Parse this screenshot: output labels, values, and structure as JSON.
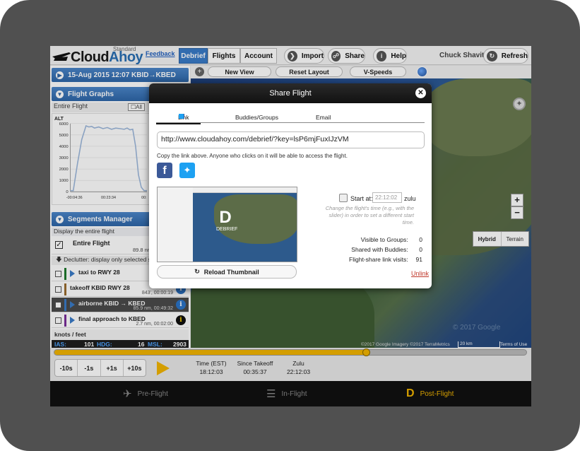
{
  "app": {
    "logo_text_a": "Cloud",
    "logo_text_b": "Ahoy",
    "edition": "Standard",
    "feedback_link": "Feedback"
  },
  "nav": {
    "tabs": [
      {
        "label": "Debrief",
        "active": true
      },
      {
        "label": "Flights",
        "active": false
      },
      {
        "label": "Account",
        "active": false
      }
    ],
    "import_label": "Import",
    "share_label": "Share",
    "help_label": "Help",
    "user_name": "Chuck Shavit",
    "refresh_label": "Refresh"
  },
  "toolbar": {
    "new_view": "New View",
    "reset_layout": "Reset Layout",
    "vspeeds": "V-Speeds"
  },
  "left": {
    "flight_header": "15-Aug 2015 12:07   KBID→KBED",
    "graphs_header": "Flight Graphs",
    "graphs_sub": "Entire Flight",
    "all_button": "All",
    "segments_header": "Segments Manager",
    "segments_sub": "Display the entire flight",
    "entire_flight": {
      "title": "Entire Flight",
      "detail": "89.8 nm"
    },
    "declutter": "Declutter: display only selected s",
    "segments": [
      {
        "title": "taxi to RWY 28",
        "detail": "1605",
        "color": "#1f7a2e",
        "checked": false
      },
      {
        "title": "takeoff KBID RWY 28",
        "detail": "843', 00:00:19",
        "color": "#9a6b2e",
        "checked": false
      },
      {
        "title": "airborne KBID → KBED",
        "detail": "85.9 nm, 00:49:32",
        "color": "#3a7bc8",
        "checked": false
      },
      {
        "title": "final approach to KBED",
        "detail": "2.7 nm, 00:02:00",
        "color": "#7a2e9a",
        "checked": false
      }
    ],
    "units": "knots / feet",
    "readout": {
      "ias_label": "IAS:",
      "ias_value": "101",
      "hdg_label": "HDG:",
      "hdg_value": "16",
      "msl_label": "MSL:",
      "msl_value": "2903"
    }
  },
  "chart_data": {
    "type": "line",
    "ylabel": "ALT",
    "y_ticks": [
      0,
      1000,
      2000,
      3000,
      4000,
      5000,
      6000
    ],
    "ylim": [
      0,
      6000
    ],
    "x_ticks": [
      "-00:04:36",
      "00:23:34",
      "00:"
    ],
    "x": [
      0,
      2,
      5,
      8,
      11,
      13,
      15,
      17,
      20,
      23,
      26,
      29,
      32,
      35,
      38,
      40,
      42,
      44,
      46,
      48,
      50,
      52,
      54
    ],
    "values": [
      100,
      100,
      2500,
      4600,
      5800,
      5700,
      5750,
      5600,
      5700,
      5550,
      5650,
      5500,
      5600,
      5550,
      5500,
      5600,
      5450,
      5500,
      4000,
      1500,
      400,
      100,
      100
    ],
    "grid": true,
    "color": "#9db8dc"
  },
  "map": {
    "hybrid": "Hybrid",
    "terrain": "Terrain",
    "attribution": "©2017 Google Imagery ©2017 TerraMetrics",
    "scale": "20 km",
    "terms": "Terms of Use",
    "watermark": "© 2017 Google"
  },
  "timeline": {
    "progress": 0.66,
    "steps": [
      "-10s",
      "-1s",
      "+1s",
      "+10s"
    ],
    "time_est_label": "Time (EST)",
    "time_est_value": "18:12:03",
    "since_label": "Since Takeoff",
    "since_value": "00:35:37",
    "zulu_label": "Zulu",
    "zulu_value": "22:12:03"
  },
  "bottom_nav": {
    "pre": "Pre-Flight",
    "in": "In-Flight",
    "post": "Post-Flight"
  },
  "modal": {
    "title": "Share Flight",
    "tab_link": "Link",
    "tab_buddies": "Buddies/Groups",
    "tab_email": "Email",
    "link_value": "http://www.cloudahoy.com/debrief/?key=lsP6mjFuxIJzVM",
    "copy_hint": "Copy the link above. Anyone who clicks on it will be able to access the flight.",
    "reload_label": "Reload Thumbnail",
    "thumb_logo": "DEBRIEF",
    "start_label": "Start at:",
    "start_placeholder": "22:12:02",
    "zulu_label": "zulu",
    "change_hint": "Change the flight's time (e.g., with the slider) in order to set a different start time.",
    "visible_groups_label": "Visible to Groups:",
    "visible_groups_value": "0",
    "shared_buddies_label": "Shared with Buddies:",
    "shared_buddies_value": "0",
    "visits_label": "Flight-share link visits:",
    "visits_value": "91",
    "unlink": "Unlink"
  }
}
